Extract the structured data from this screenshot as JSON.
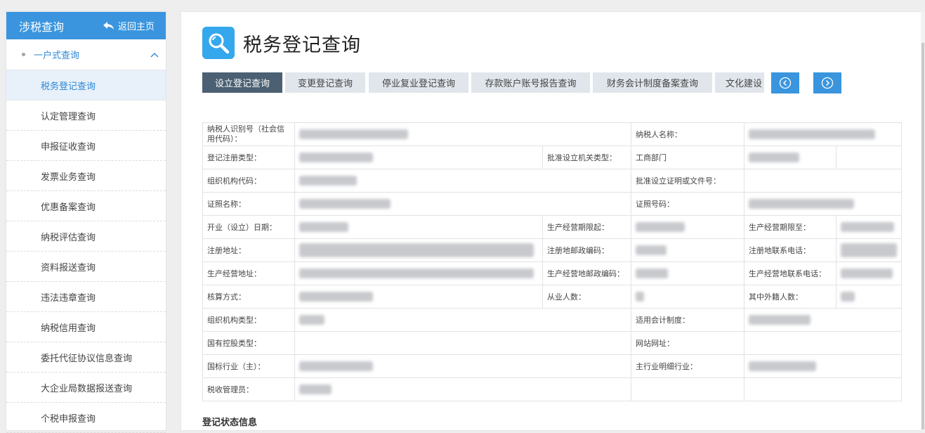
{
  "sidebar": {
    "title": "涉税查询",
    "back_label": "返回主页",
    "group_label": "一户式查询",
    "items": [
      {
        "label": "税务登记查询"
      },
      {
        "label": "认定管理查询"
      },
      {
        "label": "申报征收查询"
      },
      {
        "label": "发票业务查询"
      },
      {
        "label": "优惠备案查询"
      },
      {
        "label": "纳税评估查询"
      },
      {
        "label": "资料报送查询"
      },
      {
        "label": "违法违章查询"
      },
      {
        "label": "纳税信用查询"
      },
      {
        "label": "委托代征协议信息查询"
      },
      {
        "label": "大企业局数据报送查询"
      },
      {
        "label": "个税申报查询"
      }
    ]
  },
  "page": {
    "title": "税务登记查询",
    "icon": "search-icon"
  },
  "tabs": [
    {
      "label": "设立登记查询"
    },
    {
      "label": "变更登记查询"
    },
    {
      "label": "停业复业登记查询"
    },
    {
      "label": "存款账户账号报告查询"
    },
    {
      "label": "财务会计制度备案查询"
    },
    {
      "label": "文化建设"
    }
  ],
  "nav": {
    "prev_icon": "chevron-left-circle-icon",
    "next_icon": "chevron-right-circle-icon"
  },
  "table": {
    "taxpayer_id": "纳税人识别号（社会信用代码）：",
    "taxpayer_name": "纳税人名称：",
    "reg_type": "登记注册类型：",
    "approval_org_type": "批准设立机关类型：",
    "approval_org_value": "工商部门",
    "org_code": "组织机构代码：",
    "approval_doc_no": "批准设立证明或文件号：",
    "cert_name": "证照名称：",
    "cert_no": "证照号码：",
    "open_date": "开业（设立）日期：",
    "period_start": "生产经营期限起：",
    "period_end": "生产经营期限至：",
    "reg_address": "注册地址：",
    "reg_postcode": "注册地邮政编码：",
    "reg_phone": "注册地联系电话：",
    "biz_address": "生产经营地址：",
    "biz_postcode": "生产经营地邮政编码：",
    "biz_phone": "生产经营地联系电话：",
    "accounting_method": "核算方式：",
    "employees": "从业人数：",
    "foreign_employees": "其中外籍人数：",
    "org_type": "组织机构类型：",
    "accounting_system": "适用会计制度：",
    "state_holding": "国有控股类型：",
    "website": "网站网址：",
    "industry": "国标行业（主）：",
    "industry_detail": "主行业明细行业：",
    "tax_officer": "税收管理员："
  },
  "section_title": "登记状态信息",
  "colors": {
    "accent": "#3a95de",
    "active_tab": "#4b6072",
    "tab_bg": "#e1e6ec",
    "sidebar_active_bg": "#e8f1fa"
  }
}
